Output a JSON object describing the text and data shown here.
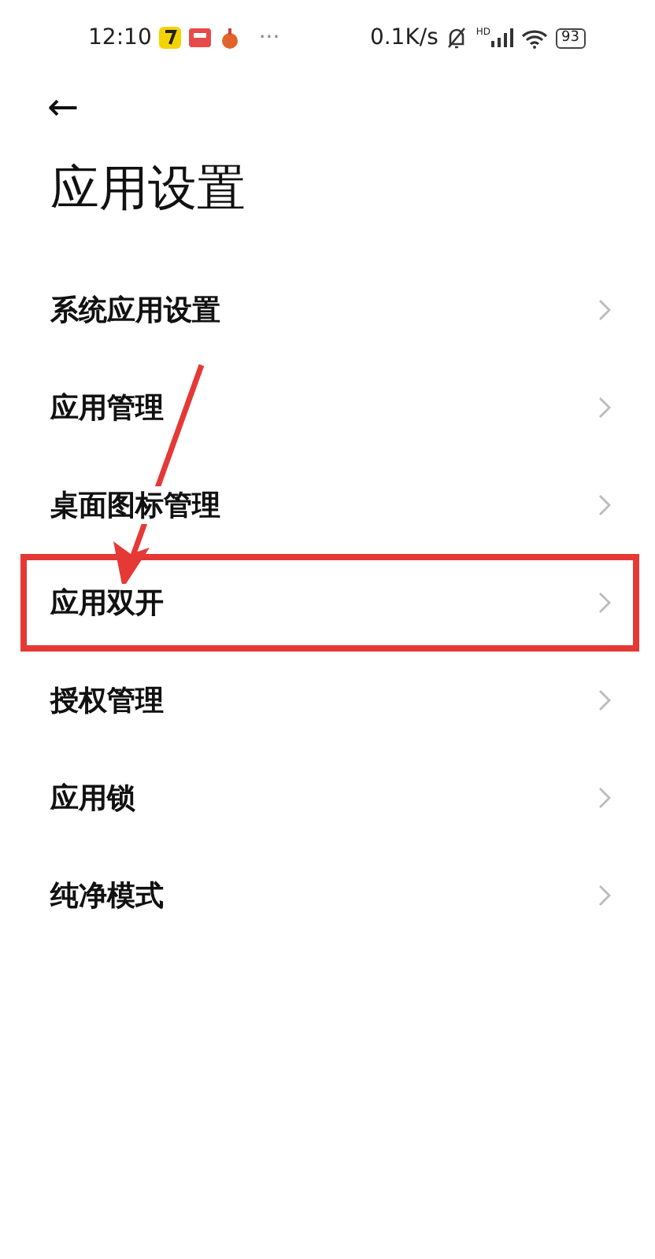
{
  "status_bar": {
    "time": "12:10",
    "more": "···",
    "speed": "0.1K/s",
    "signal_label": "HD",
    "battery": "93"
  },
  "header": {
    "back": "←",
    "title": "应用设置"
  },
  "items": [
    {
      "label": "系统应用设置",
      "highlighted": false
    },
    {
      "label": "应用管理",
      "highlighted": false
    },
    {
      "label": "桌面图标管理",
      "highlighted": false
    },
    {
      "label": "应用双开",
      "highlighted": true
    },
    {
      "label": "授权管理",
      "highlighted": false
    },
    {
      "label": "应用锁",
      "highlighted": false
    },
    {
      "label": "纯净模式",
      "highlighted": false
    }
  ],
  "annotation": {
    "kind": "arrow"
  }
}
